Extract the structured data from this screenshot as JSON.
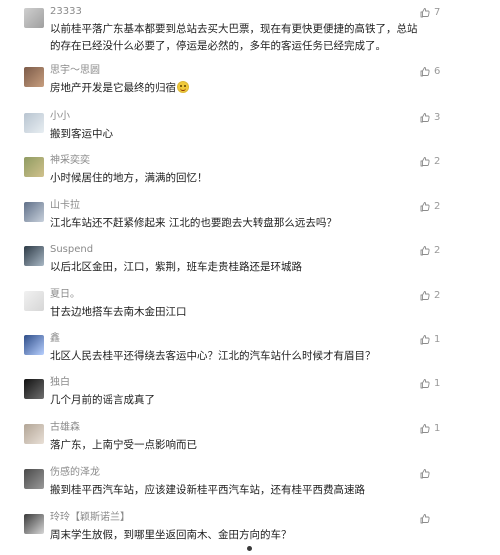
{
  "comments": [
    {
      "username": "23333",
      "text": "以前桂平落广东基本都要到总站去买大巴票，现在有更快更便捷的高铁了，总站的存在已经没什么必要了，停运是必然的，多年的客运任务已经完成了。",
      "likes": "7"
    },
    {
      "username": "思宇～思圆",
      "text": "房地产开发是它最终的归宿",
      "likes": "6"
    },
    {
      "username": "小小",
      "text": "搬到客运中心",
      "likes": "3"
    },
    {
      "username": "神采奕奕",
      "text": "小时候居住的地方，满满的回忆！",
      "likes": "2"
    },
    {
      "username": "山卡拉",
      "text": "江北车站还不赶紧修起来 江北的也要跑去大转盘那么远去吗？",
      "likes": "2"
    },
    {
      "username": "Suspend",
      "text": "以后北区金田，江口，紫荆，班车走贵桂路还是环城路",
      "likes": "2"
    },
    {
      "username": "夏日。",
      "text": "甘去边地搭车去南木金田江口",
      "likes": "2"
    },
    {
      "username": "鑫",
      "text": "北区人民去桂平还得绕去客运中心？江北的汽车站什么时候才有眉目？",
      "likes": "1"
    },
    {
      "username": "独白",
      "text": "几个月前的谣言成真了",
      "likes": "1"
    },
    {
      "username": "古雄森",
      "text": "落广东，上南宁受一点影响而已",
      "likes": "1"
    },
    {
      "username": "伤感的泽龙",
      "text": "搬到桂平西汽车站，应该建设新桂平西汽车站，还有桂平西费高速路",
      "likes": ""
    },
    {
      "username": "玲玲【颖斯诺兰】",
      "text": "周末学生放假，到哪里坐返回南木、金田方向的车？",
      "likes": ""
    }
  ],
  "icons": {
    "like": "thumbs-up-icon",
    "emoji": "smile-emoji-icon"
  }
}
